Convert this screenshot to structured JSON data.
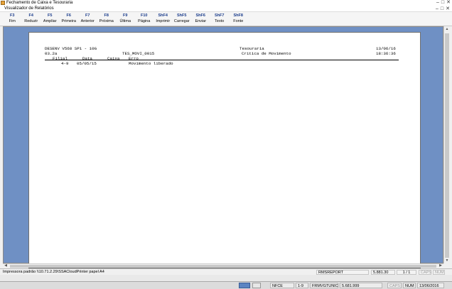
{
  "outer_window": {
    "title": "Fechamento de Caixa e Tesouraria"
  },
  "viewer_window": {
    "title": "Visualizador de Relatórios"
  },
  "toolbar": [
    {
      "key": "F3",
      "label": "Fim"
    },
    {
      "key": "F4",
      "label": "Reduzir"
    },
    {
      "key": "F5",
      "label": "Ampliar"
    },
    {
      "key": "F6",
      "label": "Primeira"
    },
    {
      "key": "F7",
      "label": "Anterior"
    },
    {
      "key": "F8",
      "label": "Próxima"
    },
    {
      "key": "F9",
      "label": "Última"
    },
    {
      "key": "F10",
      "label": "Página"
    },
    {
      "key": "ShF4",
      "label": "Imprimir"
    },
    {
      "key": "ShF5",
      "label": "Carregar"
    },
    {
      "key": "ShF6",
      "label": "Enviar"
    },
    {
      "key": "ShF7",
      "label": "Texto"
    },
    {
      "key": "ShF8",
      "label": "Fonte"
    }
  ],
  "report": {
    "system": "DESENV V568 SP1 - 10G",
    "version": "03.2a",
    "program": "TES_MOVI_0015",
    "section": "Tesouraria",
    "title": "Critica de Movimento",
    "date": "13/06/16",
    "time": "18:36:36",
    "columns": [
      "Filial",
      "Data",
      "Caixa",
      "Erro"
    ],
    "rows": [
      {
        "filial": "4-9",
        "data": "05/05/15",
        "caixa": "",
        "erro": "Movimento liberado"
      }
    ]
  },
  "status_bar": {
    "printer": "Impressora padrão \\\\10.71.2.29\\SSACloudPrinter papel A4",
    "report_name": "RMSREPORT",
    "code": "5.881.30",
    "pages": "1 / 1",
    "caps": "CAPS",
    "num": "NUM"
  },
  "taskbar": {
    "nfce": "NFCE",
    "slot": "1-9",
    "module": "FRMVGTUNIC",
    "code": "5.681.999",
    "caps": "CAPS",
    "num": "NUM",
    "date": "13/06/2016"
  }
}
